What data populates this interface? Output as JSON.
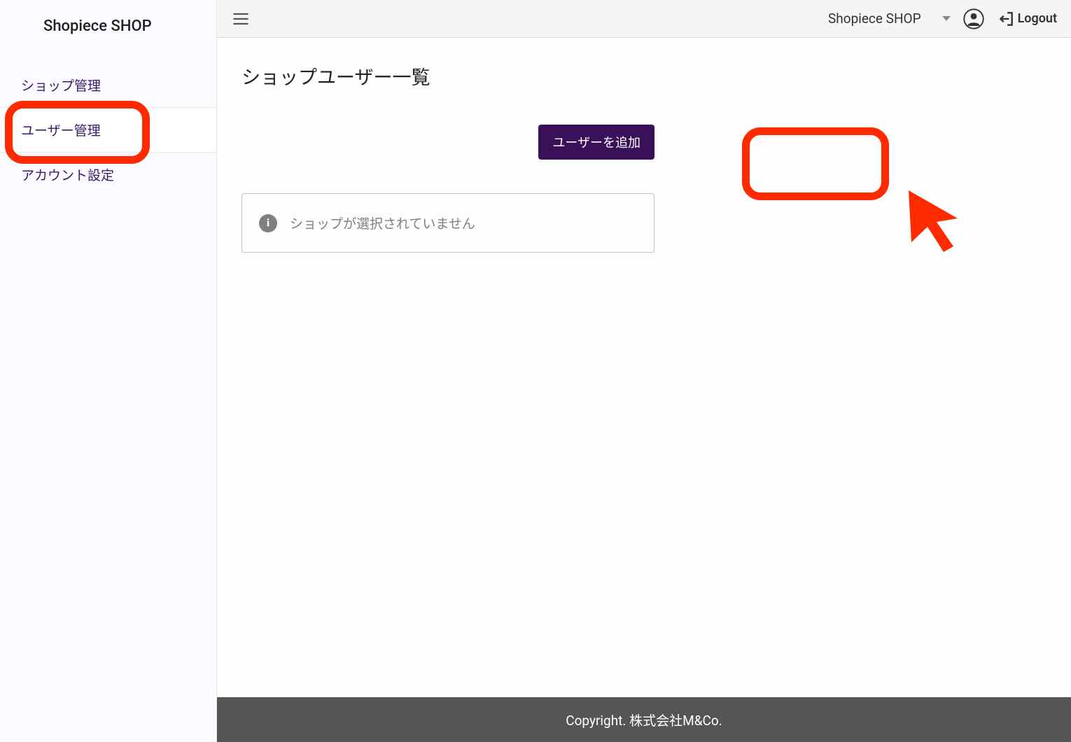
{
  "sidebar": {
    "brand": "Shopiece SHOP",
    "items": [
      {
        "label": "ショップ管理",
        "active": false
      },
      {
        "label": "ユーザー管理",
        "active": true
      },
      {
        "label": "アカウント設定",
        "active": false
      }
    ]
  },
  "topbar": {
    "shop_select_label": "Shopiece SHOP",
    "logout_label": "Logout"
  },
  "main": {
    "page_title": "ショップユーザー一覧",
    "add_user_label": "ユーザーを追加",
    "info_message": "ショップが選択されていません"
  },
  "footer": {
    "copyright": "Copyright. 株式会社M&Co."
  }
}
